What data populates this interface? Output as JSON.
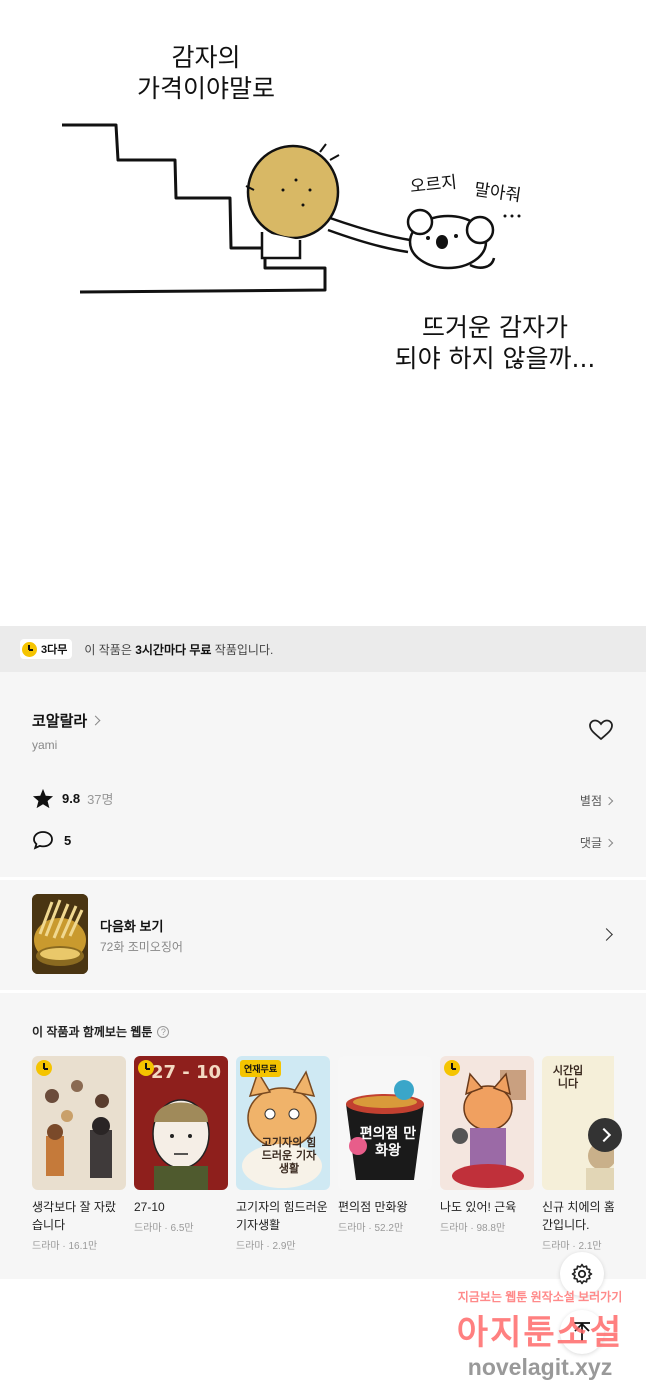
{
  "comic": {
    "caption_top": "감자의\n가격이야말로",
    "koala_text_1": "오르지",
    "koala_text_2": "말아줘",
    "caption_bottom": "뜨거운 감자가\n되야 하지 않을까..."
  },
  "free_banner": {
    "badge": "3다무",
    "text_pre": "이 작품은 ",
    "text_bold": "3시간마다 무료",
    "text_post": " 작품입니다."
  },
  "series": {
    "title": "코알랄라",
    "author": "yami",
    "rating": "9.8",
    "rating_count": "37명",
    "rating_link": "별점",
    "comment_count": "5",
    "comment_link": "댓글"
  },
  "next_episode": {
    "label": "다음화 보기",
    "subtitle": "72화 조미오징어"
  },
  "recommend": {
    "heading": "이 작품과 함께보는 웹툰",
    "items": [
      {
        "title": "생각보다 잘 자랐습니다",
        "meta": "드라마 · 16.1만",
        "badge": "wait"
      },
      {
        "title": "27-10",
        "meta": "드라마 · 6.5만",
        "badge": "wait",
        "cover_text": "27 - 10"
      },
      {
        "title": "고기자의 힘드러운 기자생활",
        "meta": "드라마 · 2.9만",
        "badge": "연재무료",
        "cover_text": "고기자의 힘드러운 기자생활"
      },
      {
        "title": "편의점 만화왕",
        "meta": "드라마 · 52.2만",
        "badge": "none",
        "cover_text": "편의점 만화왕"
      },
      {
        "title": "나도 있어! 근육",
        "meta": "드라마 · 98.8만",
        "badge": "wait"
      },
      {
        "title": "신규 치에의 홈 시간입니다.",
        "meta": "드라마 · 2.1만",
        "badge": "none",
        "cover_text": "시간입니다"
      }
    ]
  },
  "watermark": {
    "line1": "지금보는 웹툰 원작소설 보러가기",
    "line2": "아지툰소설",
    "line3": "novelagit.xyz"
  },
  "colors": {
    "accent_yellow": "#f5c400",
    "section_bg": "#f6f6f6",
    "banner_bg": "#ebebeb"
  }
}
